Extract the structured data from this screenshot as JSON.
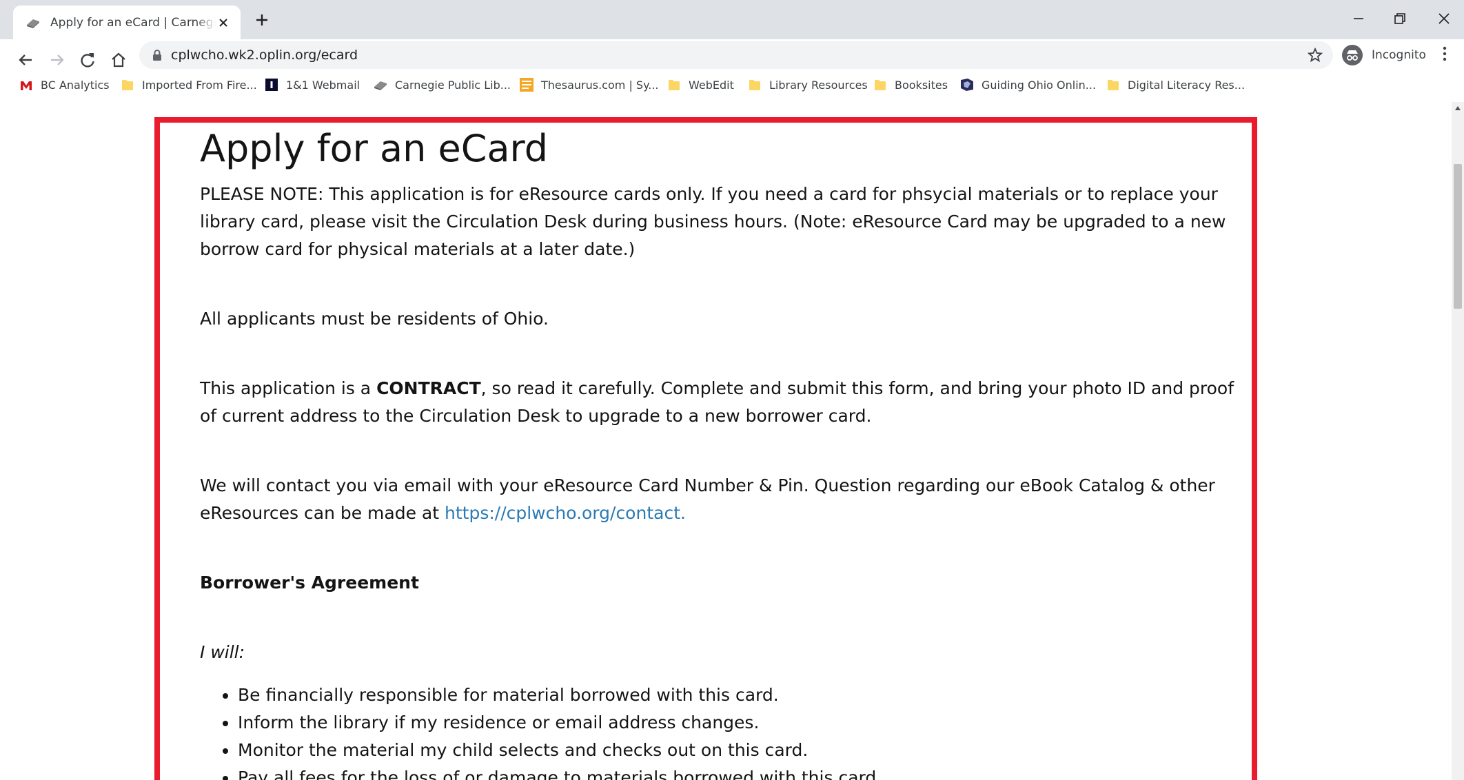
{
  "browser": {
    "tab": {
      "title": "Apply for an eCard | Carnegie Public Library"
    },
    "address": {
      "url": "cplwcho.wk2.oplin.org/ecard"
    },
    "profile": {
      "label": "Incognito"
    },
    "bookmarks": [
      {
        "label": "BC Analytics",
        "icon": "bc-analytics-icon"
      },
      {
        "label": "Imported From Fire...",
        "icon": "folder-icon"
      },
      {
        "label": "1&1 Webmail",
        "icon": "webmail-icon"
      },
      {
        "label": "Carnegie Public Lib...",
        "icon": "library-icon"
      },
      {
        "label": "Thesaurus.com | Sy...",
        "icon": "thesaurus-icon"
      },
      {
        "label": "WebEdit",
        "icon": "folder-icon"
      },
      {
        "label": "Library Resources",
        "icon": "folder-icon"
      },
      {
        "label": "Booksites",
        "icon": "folder-icon"
      },
      {
        "label": "Guiding Ohio Onlin...",
        "icon": "guiding-ohio-icon"
      },
      {
        "label": "Digital Literacy Res...",
        "icon": "folder-icon"
      }
    ],
    "colors": {
      "accent_border": "#e81c2c",
      "link": "#2a7ab5",
      "folder": "#fcd663"
    }
  },
  "page": {
    "title": "Apply for an eCard",
    "note": "PLEASE NOTE: This application is for eResource cards only. If you need a card for phsycial materials or to replace your library card, please visit the Circulation Desk during business hours. (Note: eResource Card may be upgraded to a new borrow card for physical materials at a later date.)",
    "residents": "All applicants must be residents of Ohio.",
    "contract": {
      "before": "This application is a ",
      "bold": "CONTRACT",
      "after": ", so read it carefully. Complete and submit this form, and bring your photo ID and proof of current address to the Circulation Desk to upgrade to a new borrower card."
    },
    "contact": {
      "text": "We will contact you via email with your eResource Card Number & Pin. Question regarding our eBook Catalog & other eResources can be made at ",
      "link": "https://cplwcho.org/contact."
    },
    "agreement_heading": "Borrower's Agreement",
    "i_will": "I will:",
    "list": [
      "Be financially responsible for material borrowed with this card.",
      "Inform the library if my residence or email address changes.",
      "Monitor the material my child selects and checks out on this card.",
      "Pay all fees for the loss of or damage to materials borrowed with this card."
    ]
  }
}
